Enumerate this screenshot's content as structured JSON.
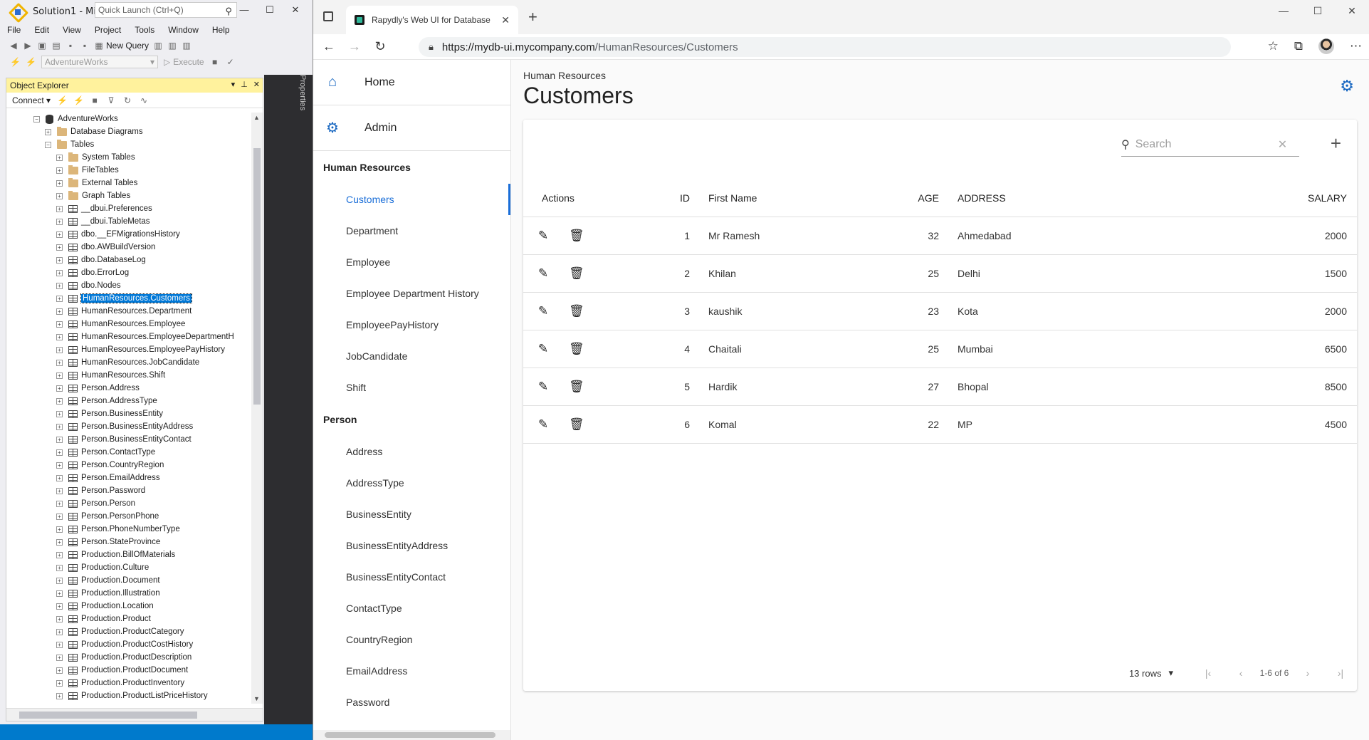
{
  "ssms": {
    "title": "Solution1 - Mi...",
    "quick_launch_placeholder": "Quick Launch (Ctrl+Q)",
    "menu": [
      "File",
      "Edit",
      "View",
      "Project",
      "Tools",
      "Window",
      "Help"
    ],
    "new_query_label": "New Query",
    "database_selected": "AdventureWorks",
    "execute_label": "Execute",
    "object_explorer": {
      "title": "Object Explorer",
      "connect_label": "Connect",
      "tree": [
        {
          "label": "AdventureWorks",
          "indent": 0,
          "icon": "database-icon",
          "expander": "−"
        },
        {
          "label": "Database Diagrams",
          "indent": 1,
          "icon": "folder-icon",
          "expander": "+"
        },
        {
          "label": "Tables",
          "indent": 1,
          "icon": "folder-icon",
          "expander": "−"
        },
        {
          "label": "System Tables",
          "indent": 2,
          "icon": "folder-icon",
          "expander": "+"
        },
        {
          "label": "FileTables",
          "indent": 2,
          "icon": "folder-icon",
          "expander": "+"
        },
        {
          "label": "External Tables",
          "indent": 2,
          "icon": "folder-icon",
          "expander": "+"
        },
        {
          "label": "Graph Tables",
          "indent": 2,
          "icon": "folder-icon",
          "expander": "+"
        },
        {
          "label": "__dbui.Preferences",
          "indent": 2,
          "icon": "table-icon",
          "expander": "+"
        },
        {
          "label": "__dbui.TableMetas",
          "indent": 2,
          "icon": "table-icon",
          "expander": "+"
        },
        {
          "label": "dbo.__EFMigrationsHistory",
          "indent": 2,
          "icon": "table-icon",
          "expander": "+"
        },
        {
          "label": "dbo.AWBuildVersion",
          "indent": 2,
          "icon": "table-icon",
          "expander": "+"
        },
        {
          "label": "dbo.DatabaseLog",
          "indent": 2,
          "icon": "table-icon",
          "expander": "+"
        },
        {
          "label": "dbo.ErrorLog",
          "indent": 2,
          "icon": "table-icon",
          "expander": "+"
        },
        {
          "label": "dbo.Nodes",
          "indent": 2,
          "icon": "table-icon",
          "expander": "+"
        },
        {
          "label": "HumanResources.Customers",
          "indent": 2,
          "icon": "table-icon",
          "expander": "+",
          "selected": true
        },
        {
          "label": "HumanResources.Department",
          "indent": 2,
          "icon": "table-icon",
          "expander": "+"
        },
        {
          "label": "HumanResources.Employee",
          "indent": 2,
          "icon": "table-icon",
          "expander": "+"
        },
        {
          "label": "HumanResources.EmployeeDepartmentH",
          "indent": 2,
          "icon": "table-icon",
          "expander": "+"
        },
        {
          "label": "HumanResources.EmployeePayHistory",
          "indent": 2,
          "icon": "table-icon",
          "expander": "+"
        },
        {
          "label": "HumanResources.JobCandidate",
          "indent": 2,
          "icon": "table-icon",
          "expander": "+"
        },
        {
          "label": "HumanResources.Shift",
          "indent": 2,
          "icon": "table-icon",
          "expander": "+"
        },
        {
          "label": "Person.Address",
          "indent": 2,
          "icon": "table-icon",
          "expander": "+"
        },
        {
          "label": "Person.AddressType",
          "indent": 2,
          "icon": "table-icon",
          "expander": "+"
        },
        {
          "label": "Person.BusinessEntity",
          "indent": 2,
          "icon": "table-icon",
          "expander": "+"
        },
        {
          "label": "Person.BusinessEntityAddress",
          "indent": 2,
          "icon": "table-icon",
          "expander": "+"
        },
        {
          "label": "Person.BusinessEntityContact",
          "indent": 2,
          "icon": "table-icon",
          "expander": "+"
        },
        {
          "label": "Person.ContactType",
          "indent": 2,
          "icon": "table-icon",
          "expander": "+"
        },
        {
          "label": "Person.CountryRegion",
          "indent": 2,
          "icon": "table-icon",
          "expander": "+"
        },
        {
          "label": "Person.EmailAddress",
          "indent": 2,
          "icon": "table-icon",
          "expander": "+"
        },
        {
          "label": "Person.Password",
          "indent": 2,
          "icon": "table-icon",
          "expander": "+"
        },
        {
          "label": "Person.Person",
          "indent": 2,
          "icon": "table-icon",
          "expander": "+"
        },
        {
          "label": "Person.PersonPhone",
          "indent": 2,
          "icon": "table-icon",
          "expander": "+"
        },
        {
          "label": "Person.PhoneNumberType",
          "indent": 2,
          "icon": "table-icon",
          "expander": "+"
        },
        {
          "label": "Person.StateProvince",
          "indent": 2,
          "icon": "table-icon",
          "expander": "+"
        },
        {
          "label": "Production.BillOfMaterials",
          "indent": 2,
          "icon": "table-icon",
          "expander": "+"
        },
        {
          "label": "Production.Culture",
          "indent": 2,
          "icon": "table-icon",
          "expander": "+"
        },
        {
          "label": "Production.Document",
          "indent": 2,
          "icon": "table-icon",
          "expander": "+"
        },
        {
          "label": "Production.Illustration",
          "indent": 2,
          "icon": "table-icon",
          "expander": "+"
        },
        {
          "label": "Production.Location",
          "indent": 2,
          "icon": "table-icon",
          "expander": "+"
        },
        {
          "label": "Production.Product",
          "indent": 2,
          "icon": "table-icon",
          "expander": "+"
        },
        {
          "label": "Production.ProductCategory",
          "indent": 2,
          "icon": "table-icon",
          "expander": "+"
        },
        {
          "label": "Production.ProductCostHistory",
          "indent": 2,
          "icon": "table-icon",
          "expander": "+"
        },
        {
          "label": "Production.ProductDescription",
          "indent": 2,
          "icon": "table-icon",
          "expander": "+"
        },
        {
          "label": "Production.ProductDocument",
          "indent": 2,
          "icon": "table-icon",
          "expander": "+"
        },
        {
          "label": "Production.ProductInventory",
          "indent": 2,
          "icon": "table-icon",
          "expander": "+"
        },
        {
          "label": "Production.ProductListPriceHistory",
          "indent": 2,
          "icon": "table-icon",
          "expander": "+"
        }
      ]
    },
    "properties_label": "Properties"
  },
  "browser": {
    "tab_title": "Rapydly's Web UI for Database",
    "url_host": "https://mydb-ui.mycompany.com",
    "url_path": "/HumanResources/Customers"
  },
  "app": {
    "nav_top": [
      {
        "label": "Home",
        "icon": "home-icon"
      },
      {
        "label": "Admin",
        "icon": "gear-icon"
      }
    ],
    "groups": [
      {
        "title": "Human Resources",
        "items": [
          "Customers",
          "Department",
          "Employee",
          "Employee Department History",
          "EmployeePayHistory",
          "JobCandidate",
          "Shift"
        ],
        "active": "Customers"
      },
      {
        "title": "Person",
        "items": [
          "Address",
          "AddressType",
          "BusinessEntity",
          "BusinessEntityAddress",
          "BusinessEntityContact",
          "ContactType",
          "CountryRegion",
          "EmailAddress",
          "Password"
        ]
      }
    ],
    "breadcrumb": "Human Resources",
    "page_title": "Customers",
    "search_placeholder": "Search",
    "columns": {
      "actions": "Actions",
      "id": "ID",
      "first_name": "First Name",
      "age": "AGE",
      "address": "ADDRESS",
      "salary": "SALARY"
    },
    "rows": [
      {
        "id": "1",
        "first_name": "Mr Ramesh",
        "age": "32",
        "address": "Ahmedabad",
        "salary": "2000"
      },
      {
        "id": "2",
        "first_name": "Khilan",
        "age": "25",
        "address": "Delhi",
        "salary": "1500"
      },
      {
        "id": "3",
        "first_name": "kaushik",
        "age": "23",
        "address": "Kota",
        "salary": "2000"
      },
      {
        "id": "4",
        "first_name": "Chaitali",
        "age": "25",
        "address": "Mumbai",
        "salary": "6500"
      },
      {
        "id": "5",
        "first_name": "Hardik",
        "age": "27",
        "address": "Bhopal",
        "salary": "8500"
      },
      {
        "id": "6",
        "first_name": "Komal",
        "age": "22",
        "address": "MP",
        "salary": "4500"
      }
    ],
    "pager": {
      "rows_per_page": "13 rows",
      "range": "1-6 of 6"
    },
    "accent_color": "#1a6ed8"
  }
}
